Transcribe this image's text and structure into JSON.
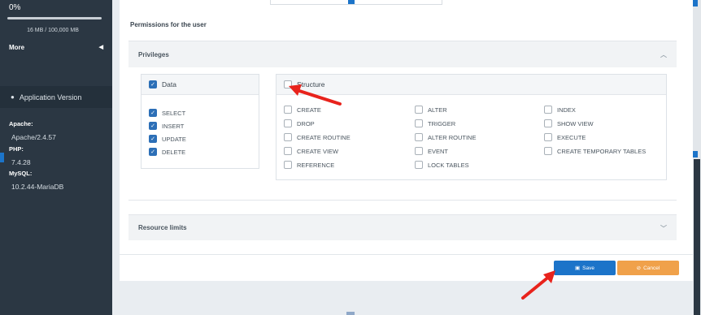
{
  "sidebar": {
    "usage_percent_label": "0%",
    "usage_fraction": 0.0,
    "usage_text": "16 MB / 100,000 MB",
    "more_label": "More",
    "more_chevron": "chevron-left-icon",
    "version_label": "Application Version",
    "version_icon": "drop-icon",
    "apache_label": "Apache:",
    "apache_value": "Apache/2.4.57",
    "php_label": "PHP:",
    "php_value": "7.4.28",
    "mysql_label": "MySQL:",
    "mysql_value": "10.2.44-MariaDB"
  },
  "main": {
    "section_title": "Permissions for the user",
    "privileges": {
      "title": "Privileges",
      "data": {
        "label": "Data",
        "checked": true,
        "options": [
          {
            "label": "SELECT",
            "checked": true
          },
          {
            "label": "INSERT",
            "checked": true
          },
          {
            "label": "UPDATE",
            "checked": true
          },
          {
            "label": "DELETE",
            "checked": true
          }
        ]
      },
      "structure": {
        "label": "Structure",
        "checked": false,
        "col1": [
          {
            "label": "CREATE",
            "checked": false
          },
          {
            "label": "DROP",
            "checked": false
          },
          {
            "label": "CREATE ROUTINE",
            "checked": false
          },
          {
            "label": "CREATE VIEW",
            "checked": false
          },
          {
            "label": "REFERENCE",
            "checked": false
          }
        ],
        "col2": [
          {
            "label": "ALTER",
            "checked": false
          },
          {
            "label": "TRIGGER",
            "checked": false
          },
          {
            "label": "ALTER ROUTINE",
            "checked": false
          },
          {
            "label": "EVENT",
            "checked": false
          },
          {
            "label": "LOCK TABLES",
            "checked": false
          }
        ],
        "col3": [
          {
            "label": "INDEX",
            "checked": false
          },
          {
            "label": "SHOW VIEW",
            "checked": false
          },
          {
            "label": "EXECUTE",
            "checked": false
          },
          {
            "label": "CREATE TEMPORARY TABLES",
            "checked": false
          }
        ]
      }
    },
    "resource_limits": {
      "title": "Resource limits"
    },
    "buttons": {
      "save_label": "Save",
      "save_icon": "floppy-disk-icon",
      "cancel_label": "Cancel",
      "cancel_icon": "cancel-circle-icon"
    }
  },
  "colors": {
    "sidebar_bg": "#2b3743",
    "primary": "#1c74c9",
    "checkbox_checked": "#2c6fb7",
    "cancel": "#f0a14a",
    "annotation_arrow": "#e8231c"
  }
}
